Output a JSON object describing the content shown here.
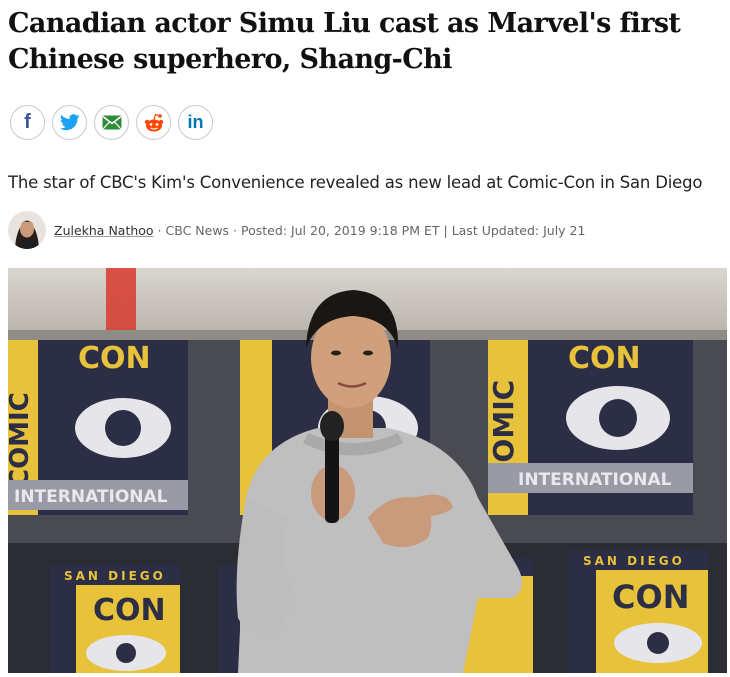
{
  "article": {
    "headline": "Canadian actor Simu Liu cast as Marvel's first Chinese superhero, Shang-Chi",
    "subtitle": "The star of CBC's Kim's Convenience revealed as new lead at Comic-Con in San Diego"
  },
  "share": [
    {
      "name": "facebook",
      "glyph": "f",
      "color": "#3b5998"
    },
    {
      "name": "twitter",
      "color": "#1da1f2"
    },
    {
      "name": "email",
      "color": "#2e8b3a"
    },
    {
      "name": "reddit",
      "color": "#ff4500"
    },
    {
      "name": "linkedin",
      "glyph": "in",
      "color": "#0077b5"
    }
  ],
  "byline": {
    "author": "Zulekha Nathoo",
    "sep1": " · ",
    "outlet": "CBC News",
    "sep2": " · ",
    "posted": "Posted: Jul 20, 2019 9:18 PM ET",
    "sep3": " | ",
    "updated": "Last Updated: July 21"
  },
  "hero_image": {
    "banner_top_text": "COMIC-CON",
    "banner_sub_text": "INTERNATIONAL",
    "banner_city_text": "SAN DIEGO",
    "banner_con_text": "CON",
    "banner_comic_text": "COMIC",
    "colors": {
      "gold": "#e8c23a",
      "navy": "#2b2e45",
      "shirt": "#bfbfbf"
    }
  }
}
